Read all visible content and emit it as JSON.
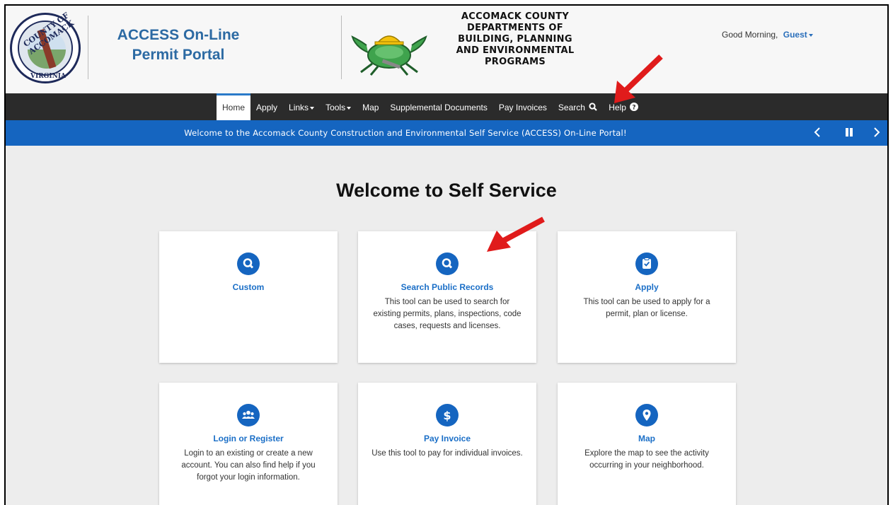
{
  "header": {
    "seal_top": "COUNTY OF ACCOMACK",
    "seal_bottom": "VIRGINIA",
    "portal_title_line1": "ACCESS On-Line",
    "portal_title_line2": "Permit Portal",
    "dept_line1": "ACCOMACK COUNTY",
    "dept_line2": "DEPARTMENTS OF",
    "dept_line3": "BUILDING, PLANNING",
    "dept_line4": "AND ENVIRONMENTAL",
    "dept_line5": "PROGRAMS",
    "greeting": "Good Morning,",
    "user": "Guest"
  },
  "nav": {
    "home": "Home",
    "apply": "Apply",
    "links": "Links",
    "tools": "Tools",
    "map": "Map",
    "supplemental": "Supplemental Documents",
    "pay_invoices": "Pay Invoices",
    "search": "Search",
    "help": "Help"
  },
  "banner": {
    "text": "Welcome to the Accomack County Construction and Environmental Self Service (ACCESS) On-Line Portal!"
  },
  "main": {
    "heading": "Welcome to Self Service",
    "cards": [
      {
        "title": "Custom",
        "desc": "",
        "icon": "search-icon"
      },
      {
        "title": "Search Public Records",
        "desc": "This tool can be used to search for existing permits, plans, inspections, code cases, requests and licenses.",
        "icon": "search-icon"
      },
      {
        "title": "Apply",
        "desc": "This tool can be used to apply for a permit, plan or license.",
        "icon": "clipboard-check-icon"
      },
      {
        "title": "Login or Register",
        "desc": "Login to an existing or create a new account. You can also find help if you forgot your login information.",
        "icon": "users-icon"
      },
      {
        "title": "Pay Invoice",
        "desc": "Use this tool to pay for individual invoices.",
        "icon": "dollar-icon"
      },
      {
        "title": "Map",
        "desc": "Explore the map to see the activity occurring in your neighborhood.",
        "icon": "map-pin-icon"
      }
    ]
  },
  "colors": {
    "brand_blue": "#1565c0",
    "title_blue": "#2c6aa3",
    "navbar": "#2b2b2b",
    "arrow_red": "#e01b1b"
  }
}
